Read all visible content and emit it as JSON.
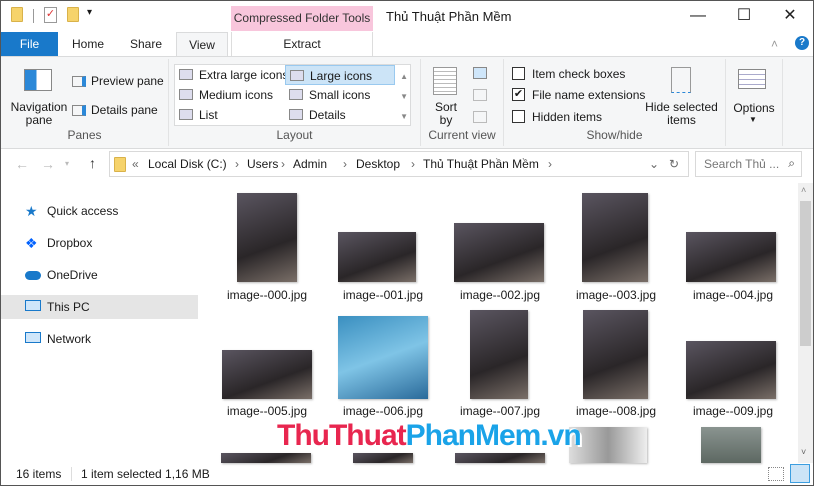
{
  "window": {
    "title": "Thủ Thuật Phần Mềm",
    "context_tab": "Compressed Folder Tools",
    "minimize": "—",
    "maximize": "☐",
    "close": "✕"
  },
  "tabs": {
    "file": "File",
    "home": "Home",
    "share": "Share",
    "view": "View",
    "extract": "Extract"
  },
  "ribbon": {
    "panes": {
      "navigation_pane": "Navigation pane",
      "preview_pane": "Preview pane",
      "details_pane": "Details pane",
      "label": "Panes"
    },
    "layout": {
      "items": [
        "Extra large icons",
        "Large icons",
        "Medium icons",
        "Small icons",
        "List",
        "Details"
      ],
      "selected": "Large icons",
      "label": "Layout"
    },
    "current_view": {
      "sort_by": "Sort by",
      "label": "Current view"
    },
    "show_hide": {
      "item_check_boxes": "Item check boxes",
      "file_name_extensions": "File name extensions",
      "hidden_items": "Hidden items",
      "hide_selected": "Hide selected items",
      "label": "Show/hide",
      "checked": {
        "item_check_boxes": false,
        "file_name_extensions": true,
        "hidden_items": false
      }
    },
    "options": "Options"
  },
  "address": {
    "prefix": "«",
    "crumbs": [
      "Local Disk (C:)",
      "Users",
      "Admin",
      "Desktop",
      "Thủ Thuật Phần Mềm"
    ],
    "search_placeholder": "Search Thủ ..."
  },
  "nav": [
    "Quick access",
    "Dropbox",
    "OneDrive",
    "This PC",
    "Network"
  ],
  "files": [
    "image--000.jpg",
    "image--001.jpg",
    "image--002.jpg",
    "image--003.jpg",
    "image--004.jpg",
    "image--005.jpg",
    "image--006.jpg",
    "image--007.jpg",
    "image--008.jpg",
    "image--009.jpg"
  ],
  "status": {
    "count": "16 items",
    "selection": "1 item selected  1,16 MB"
  },
  "watermark": {
    "part1": "ThuThuat",
    "part2": "PhanMem.vn"
  },
  "colors": {
    "accent": "#1979ca",
    "context": "#f8c6dc"
  }
}
